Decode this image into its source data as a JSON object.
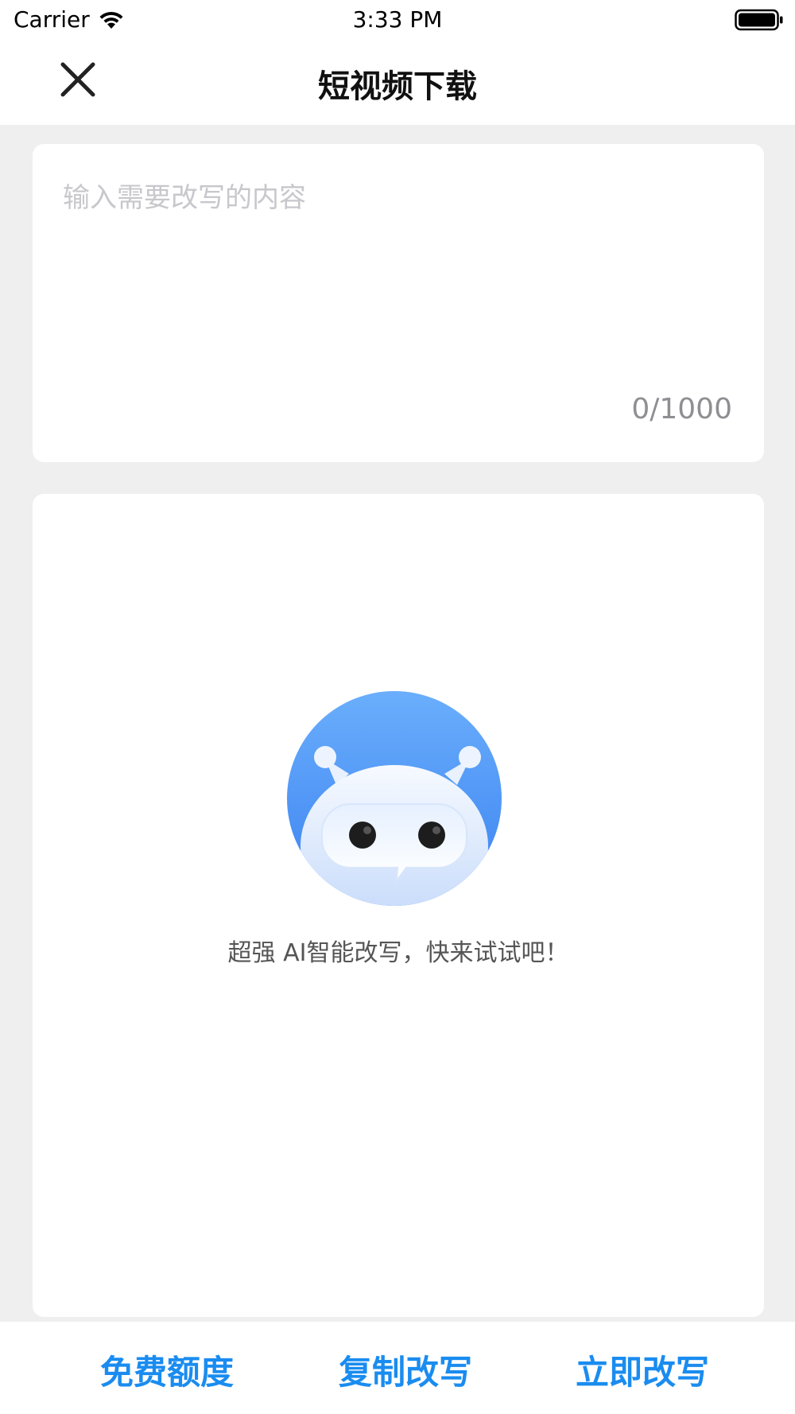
{
  "status_bar": {
    "carrier": "Carrier",
    "time": "3:33 PM",
    "wifi_icon": "wifi-icon",
    "battery_icon": "battery-full-icon"
  },
  "nav": {
    "title": "短视频下载",
    "close_icon": "close-icon"
  },
  "input": {
    "placeholder": "输入需要改写的内容",
    "value": "",
    "counter": "0/1000"
  },
  "result": {
    "illustration_icon": "robot-icon",
    "hint": "超强 AI智能改写，快来试试吧！"
  },
  "bottom_bar": {
    "free_quota_label": "免费额度",
    "copy_rewrite_label": "复制改写",
    "rewrite_now_label": "立即改写"
  },
  "colors": {
    "accent": "#1a8cf0",
    "background": "#efefef",
    "card": "#ffffff",
    "placeholder": "#c7c7cc"
  }
}
